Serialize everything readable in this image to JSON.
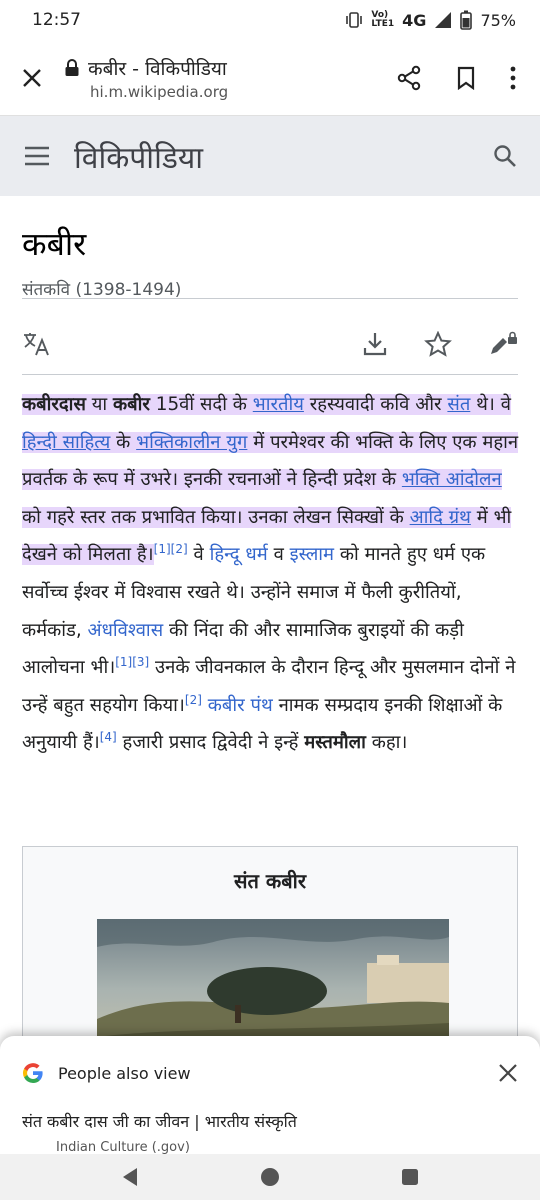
{
  "status": {
    "time": "12:57",
    "network": "4G",
    "battery": "75%"
  },
  "browser": {
    "title": "कबीर - विकिपीडिया",
    "domain": "hi.m.wikipedia.org"
  },
  "wiki": {
    "brand": "विकिपीडिया"
  },
  "article": {
    "title": "कबीर",
    "description": "संतकवि (1398-1494)",
    "p": [
      "कबीरदास",
      " या ",
      "कबीर",
      " 15वीं सदी के ",
      "भारतीय",
      " रहस्यवादी कवि और ",
      "संत",
      " थे। वे ",
      "हिन्दी साहित्य",
      " के ",
      "भक्तिकालीन युग",
      " में परमेश्वर की भक्ति के लिए एक महान प्रवर्तक के रूप में उभरे। इनकी रचनाओं ने हिन्दी प्रदेश के ",
      "भक्ति आंदोलन",
      " को गहरे स्तर तक प्रभावित किया। उनका लेखन सिक्खों के ",
      "आदि ग्रंथ",
      " में भी देखने को मिलता है।",
      "[1]",
      "[2]",
      " वे ",
      "हिन्दू धर्म",
      " व ",
      "इस्लाम",
      " को मानते हुए धर्म एक सर्वोच्च ईश्वर में विश्वास रखते थे। उन्होंने समाज में फैली कुरीतियों, कर्मकांड, ",
      "अंधविश्वास",
      " की निंदा की और सामाजिक बुराइयों की कड़ी आलोचना भी।",
      "[1]",
      "[3]",
      " उनके जीवनकाल के दौरान हिन्दू और मुसलमान दोनों ने उन्हें बहुत सहयोग किया।",
      "[2]",
      " ",
      "कबीर पंथ",
      " नामक सम्प्रदाय इनकी शिक्षाओं के अनुयायी हैं।",
      "[4]",
      " हजारी प्रसाद द्विवेदी ने इन्हें ",
      "मस्तमौला",
      " कहा।"
    ]
  },
  "infobox": {
    "title": "संत कबीर"
  },
  "google_sheet": {
    "label": "People also view",
    "suggestion": "संत कबीर दास जी का जीवन | भारतीय संस्कृति",
    "source": "Indian Culture (.gov)"
  },
  "colors": {
    "link": "#3366cc",
    "highlight": "#e7d6fb",
    "header_bg": "#eaecf0"
  }
}
